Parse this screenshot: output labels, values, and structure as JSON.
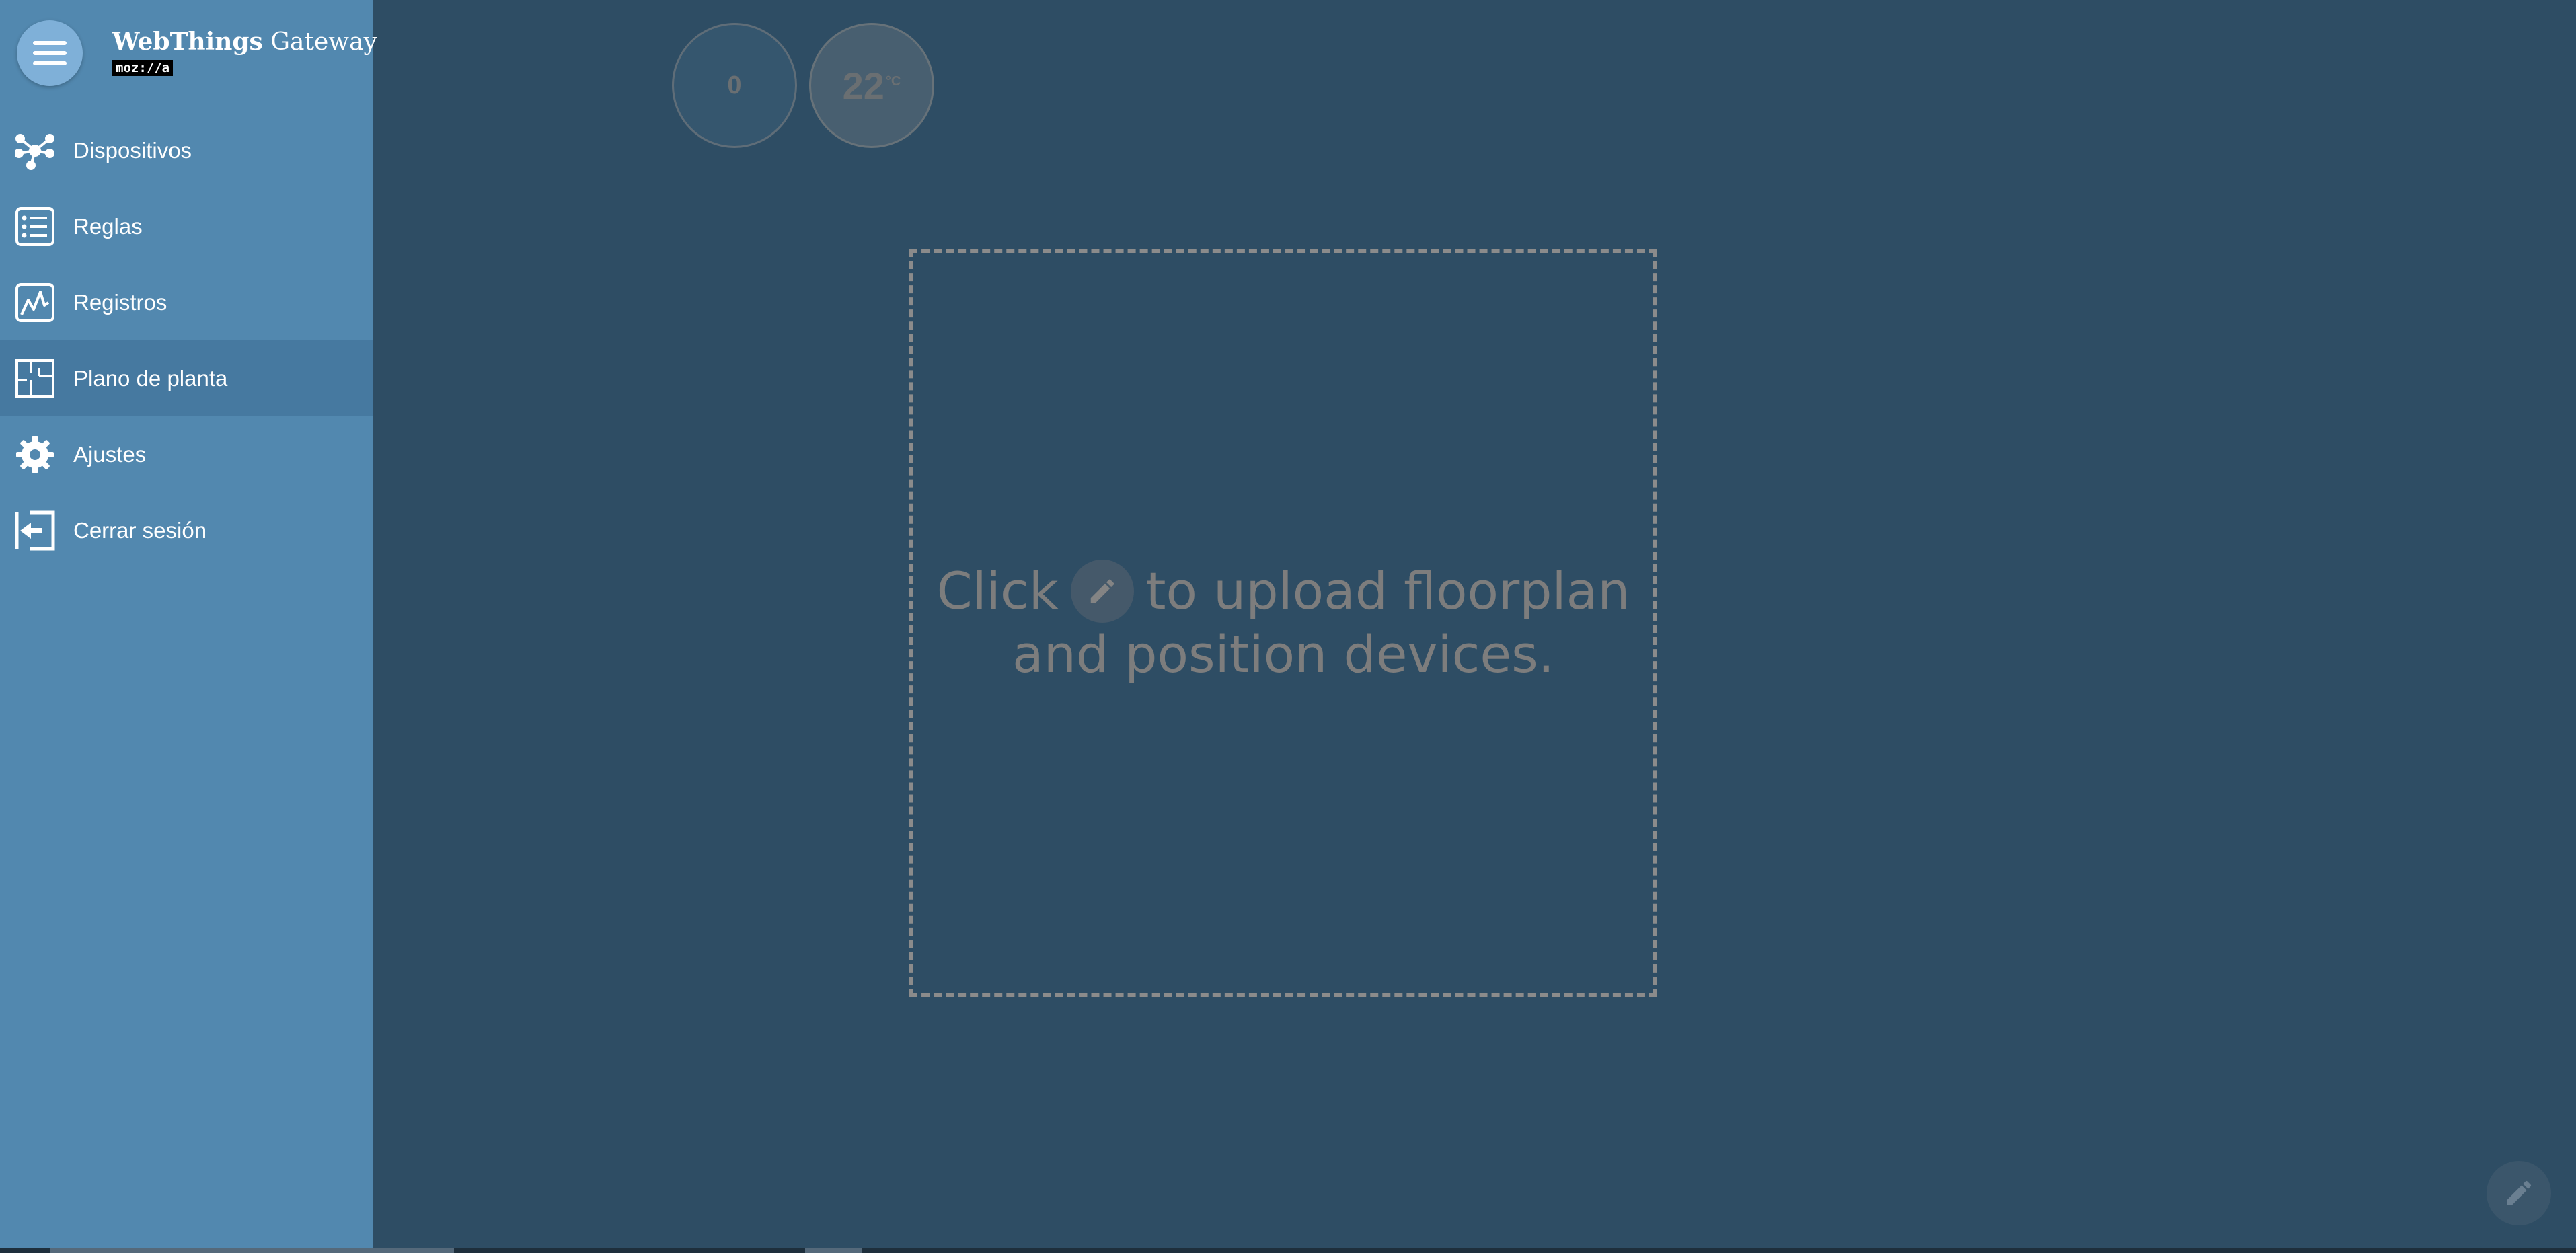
{
  "app": {
    "brand_bold": "WebThings",
    "brand_light": " Gateway",
    "badge": "moz://a"
  },
  "sidebar": {
    "items": [
      {
        "label": "Dispositivos",
        "icon": "devices-icon"
      },
      {
        "label": "Reglas",
        "icon": "rules-icon"
      },
      {
        "label": "Registros",
        "icon": "logs-icon"
      },
      {
        "label": "Plano de planta",
        "icon": "floorplan-icon",
        "active": true
      },
      {
        "label": "Ajustes",
        "icon": "gear-icon"
      },
      {
        "label": "Cerrar sesión",
        "icon": "logout-icon"
      }
    ]
  },
  "things": {
    "a_value": "0",
    "b_value": "22",
    "b_unit": "°C"
  },
  "floorplan": {
    "hint_before": "Click",
    "hint_after": "to upload floorplan",
    "hint_line2": "and position devices."
  },
  "colors": {
    "sidebar": "#5288af",
    "sidebar_active": "#4679a0",
    "main_bg": "#2e4d64"
  }
}
